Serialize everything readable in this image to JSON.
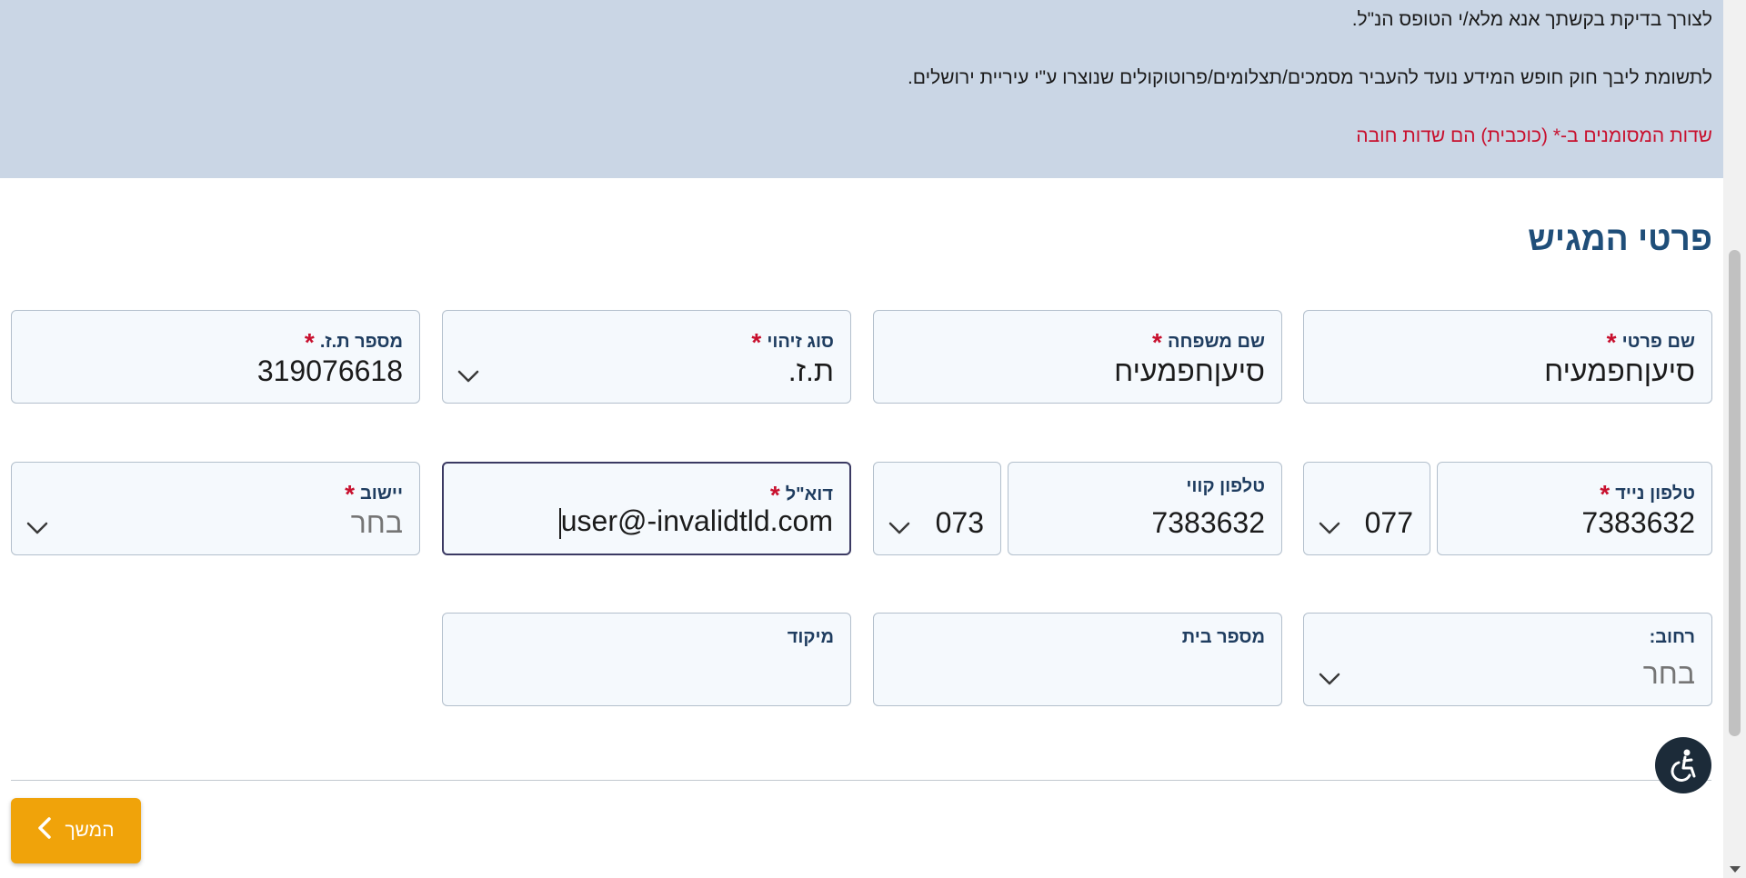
{
  "banner": {
    "line1": "לצורך בדיקת בקשתך אנא מלא/י הטופס הנ\"ל.",
    "line2": "לתשומת ליבך חוק חופש המידע נועד להעביר מסמכים/תצלומים/פרוטוקולים שנוצרו ע\"י עיריית ירושלים.",
    "line3": "שדות המסומנים ב-* (כוכבית) הם שדות חובה"
  },
  "section": {
    "title": "פרטי המגיש"
  },
  "required_mark": "*",
  "fields": {
    "first_name": {
      "label": "שם פרטי",
      "value": "סיעןחפמעיח"
    },
    "last_name": {
      "label": "שם משפחה",
      "value": "סיעןחפמעיח"
    },
    "id_type": {
      "label": "סוג זיהוי",
      "value": "ת.ז."
    },
    "id_number": {
      "label": "מספר ת.ז.",
      "value": "319076618"
    },
    "mobile": {
      "label": "טלפון נייד",
      "value": "7383632",
      "prefix": "077"
    },
    "landline": {
      "label": "טלפון קווי",
      "value": "7383632",
      "prefix": "073"
    },
    "email": {
      "label": "דוא\"ל",
      "value": "user@-invalidtld.com"
    },
    "city": {
      "label": "יישוב",
      "placeholder": "בחר"
    },
    "street": {
      "label": "רחוב:",
      "placeholder": "בחר"
    },
    "house_number": {
      "label": "מספר בית",
      "value": ""
    },
    "zip": {
      "label": "מיקוד",
      "value": ""
    }
  },
  "buttons": {
    "next_label": "המשך"
  },
  "colors": {
    "banner_bg": "#cad6e5",
    "required": "#c8102e",
    "title": "#1f4e79",
    "button": "#f0a30a"
  }
}
